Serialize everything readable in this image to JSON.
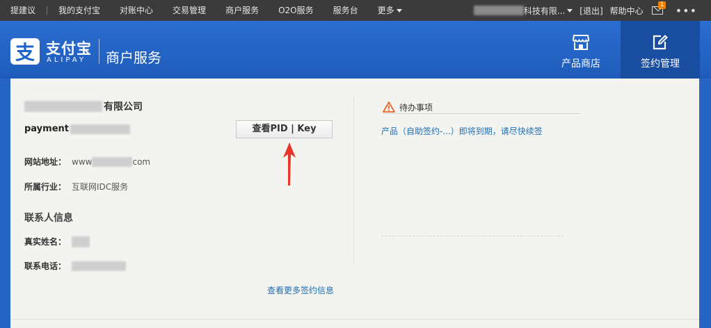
{
  "topbar": {
    "nav": [
      "提建议",
      "我的支付宝",
      "对账中心",
      "交易管理",
      "商户服务",
      "O2O服务",
      "服务台",
      "更多"
    ],
    "account_suffix": "科技有限...",
    "logout": "[退出]",
    "help": "帮助中心",
    "mail_badge": "1",
    "menu_dots": "•••"
  },
  "header": {
    "logo_mark": "支",
    "logo_cn": "支付宝",
    "logo_en": "ALIPAY",
    "biz_title": "商户服务",
    "nav": {
      "shop": "产品商店",
      "sign": "签约管理"
    }
  },
  "merchant": {
    "company_suffix": "有限公司",
    "account_prefix": "payment",
    "pid_button": "查看PID | Key",
    "website_label": "网站地址：",
    "website_prefix": "www",
    "website_suffix": "com",
    "industry_label": "所属行业：",
    "industry_value": "互联网IDC服务",
    "contact_section": "联系人信息",
    "name_label": "真实姓名：",
    "phone_label": "联系电话：",
    "more_link": "查看更多签约信息"
  },
  "todo": {
    "title": "待办事项",
    "item": "产品（自助签约-...）即将到期，请尽快续签"
  }
}
